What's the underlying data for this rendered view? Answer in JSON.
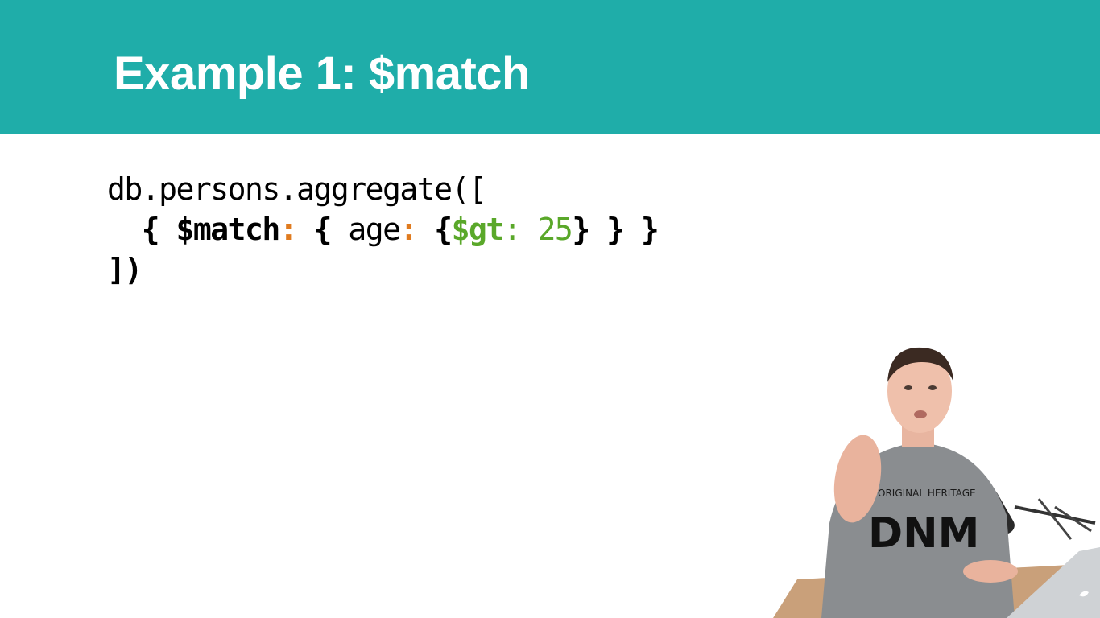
{
  "slide": {
    "title": "Example 1: $match",
    "code": {
      "line1": "db.persons.aggregate([",
      "line2": {
        "indent": "  ",
        "open1": "{ ",
        "match": "$match",
        "colon1": ":",
        "open2": " { ",
        "field": "age",
        "colon2": ":",
        "open3": " {",
        "gt": "$gt",
        "colon3": ":",
        "value": " 25",
        "close": "} } }"
      },
      "line3": "])"
    },
    "presenter": {
      "shirt_text": "ORIGINAL HERITAGE",
      "shirt_letters": "DNM"
    }
  },
  "colors": {
    "header": "#1fada9",
    "operator": "#e07b1f",
    "value": "#5aa82a"
  }
}
